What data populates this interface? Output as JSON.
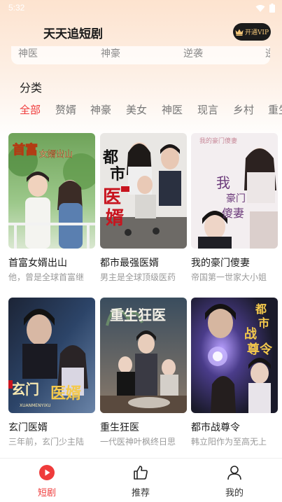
{
  "status": {
    "time": "5:32"
  },
  "app": {
    "title": "天天追短剧"
  },
  "vip": {
    "label": "开通VIP",
    "accent": "#f4c77a"
  },
  "search_strip": {
    "items": [
      "神医",
      "神豪",
      "逆袭",
      "逆"
    ]
  },
  "categories": {
    "title": "分类",
    "items": [
      "全部",
      "赘婿",
      "神豪",
      "美女",
      "神医",
      "现言",
      "乡村",
      "重生"
    ],
    "active_color": "#ef3b3b"
  },
  "dramas": [
    {
      "title": "首富女婿出山",
      "desc": "他，曾是全球首富继",
      "poster_text": "首富女婿出山"
    },
    {
      "title": "都市最强医婿",
      "desc": "男主是全球顶级医药",
      "poster_text": "都市医婿"
    },
    {
      "title": "我的豪门傻妻",
      "desc": "帝国第一世家大小姐",
      "poster_text": "我的豪门傻妻"
    },
    {
      "title": "玄门医婿",
      "desc": "三年前，玄门少主陆",
      "poster_text": "玄门医婿"
    },
    {
      "title": "重生狂医",
      "desc": "一代医神叶枫终日思",
      "poster_text": "重生狂医"
    },
    {
      "title": "都市战尊令",
      "desc": "韩立阳作为至高无上",
      "poster_text": "都市战尊令"
    }
  ],
  "tabbar": {
    "items": [
      {
        "label": "短剧",
        "icon": "play-circle-icon"
      },
      {
        "label": "推荐",
        "icon": "thumbs-up-icon"
      },
      {
        "label": "我的",
        "icon": "user-icon"
      }
    ],
    "active_color": "#ef3b3b"
  }
}
